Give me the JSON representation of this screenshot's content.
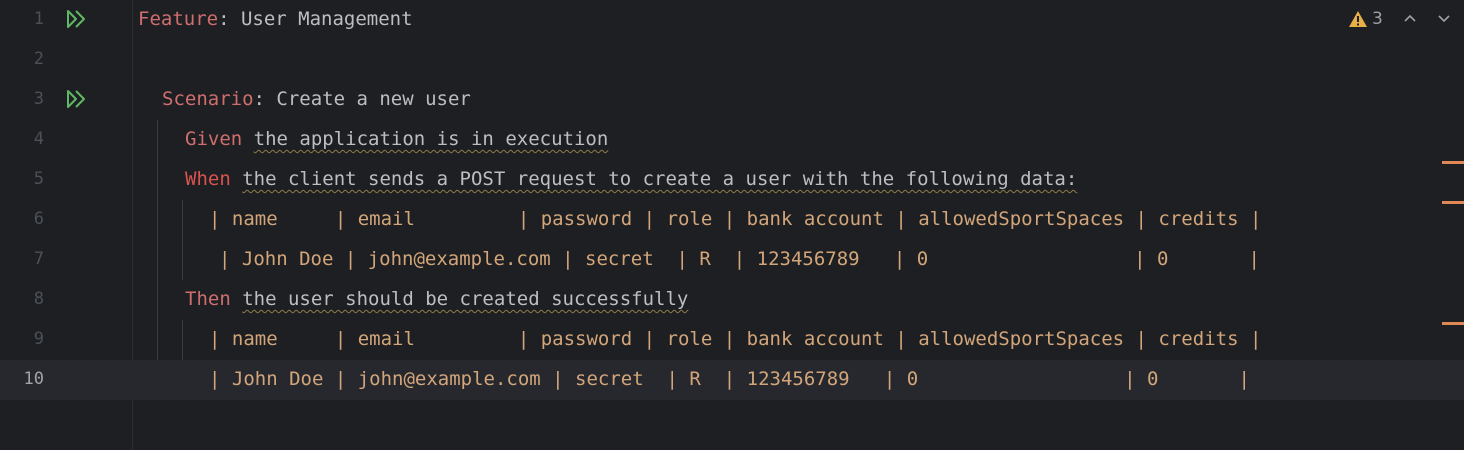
{
  "editor": {
    "line_numbers": [
      "1",
      "2",
      "3",
      "4",
      "5",
      "6",
      "7",
      "8",
      "9",
      "10"
    ],
    "current_line": "10",
    "warnings_count": "3",
    "feature_keyword": "Feature",
    "feature_title": " User Management",
    "scenario_keyword": "Scenario",
    "scenario_title": " Create a new user",
    "given_keyword": "Given",
    "given_text": "the application is in execution",
    "when_keyword": "When",
    "when_text": "the client sends a POST request to create a user with the following data:",
    "then_keyword": "Then",
    "then_text": "the user should be created successfully",
    "table1_header": "| name     | email         | password | role | bank account | allowedSportSpaces | credits |",
    "table1_row": "| John Doe | john@example.com | secret  | R  | 123456789   | 0                  | 0       |",
    "table2_header": "| name     | email         | password | role | bank account | allowedSportSpaces | credits |",
    "table2_row": "| John Doe | john@example.com | secret  | R  | 123456789   | 0                  | 0       |"
  },
  "colors": {
    "keyword": "#cf6e6e",
    "table_cell": "#d2a57a",
    "table_pipe": "#d86c6c",
    "run_icon": "#5fb865",
    "warning": "#e8ae47",
    "scroll_marker": "#e08855"
  },
  "icons": {
    "run": "double-play-icon",
    "warning": "warning-triangle-icon",
    "prev": "chevron-up-icon",
    "next": "chevron-down-icon"
  }
}
